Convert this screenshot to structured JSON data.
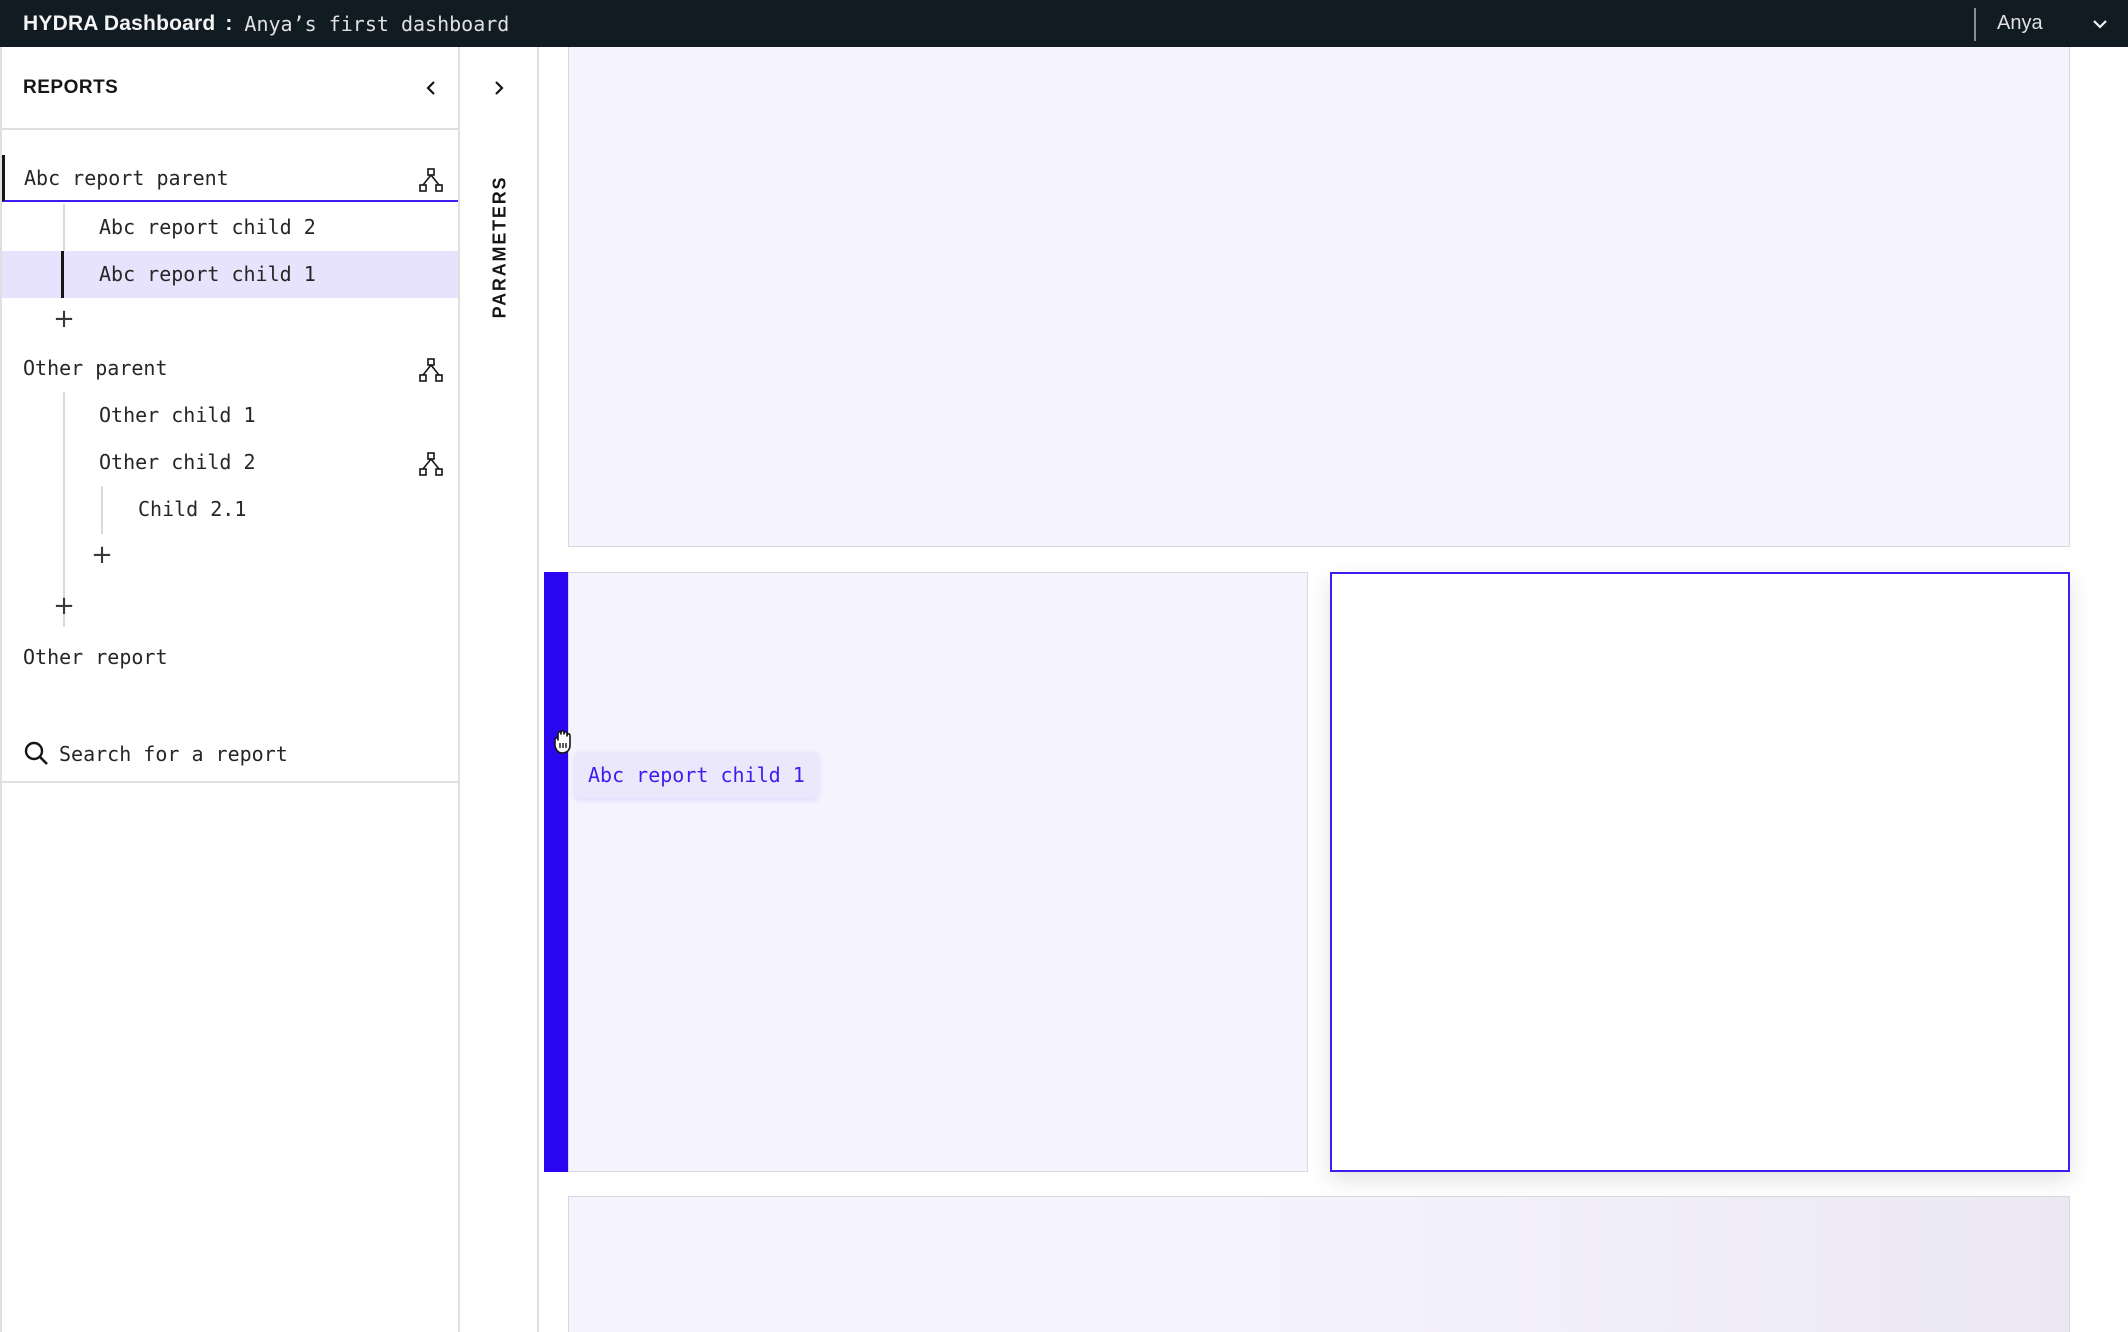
{
  "topbar": {
    "app_name": "HYDRA Dashboard",
    "separator": ":",
    "dashboard_name": "Anya’s first dashboard",
    "user_name": "Anya"
  },
  "reports": {
    "title": "REPORTS",
    "tree": [
      {
        "label": "Abc report parent",
        "level": 0,
        "active": true,
        "has_branch_icon": true
      },
      {
        "label": "Abc report child 2",
        "level": 1
      },
      {
        "label": "Abc report child 1",
        "level": 1,
        "selected": true
      },
      {
        "label": "Other parent",
        "level": 0,
        "has_branch_icon": true
      },
      {
        "label": "Other child 1",
        "level": 1
      },
      {
        "label": "Other child 2",
        "level": 1,
        "has_branch_icon": true
      },
      {
        "label": "Child 2.1",
        "level": 2
      },
      {
        "label": "Other report",
        "level": 0
      }
    ],
    "add_label": "+",
    "search_placeholder": "Search for a report"
  },
  "parameters": {
    "label": "PARAMETERS"
  },
  "canvas": {
    "drag_chip_label": "Abc report child 1"
  },
  "colors": {
    "accent": "#3c1ef0",
    "drop_indicator": "#2a06f0",
    "topbar_bg": "#111b22",
    "card_bg": "#f5f3fd",
    "selected_bg": "#e8e3fc"
  },
  "icons": {
    "collapse": "chevron-left-icon",
    "expand": "chevron-right-icon",
    "branch": "hierarchy-icon",
    "search": "search-icon",
    "user_menu": "chevron-down-icon",
    "cursor": "grab-hand-icon"
  }
}
